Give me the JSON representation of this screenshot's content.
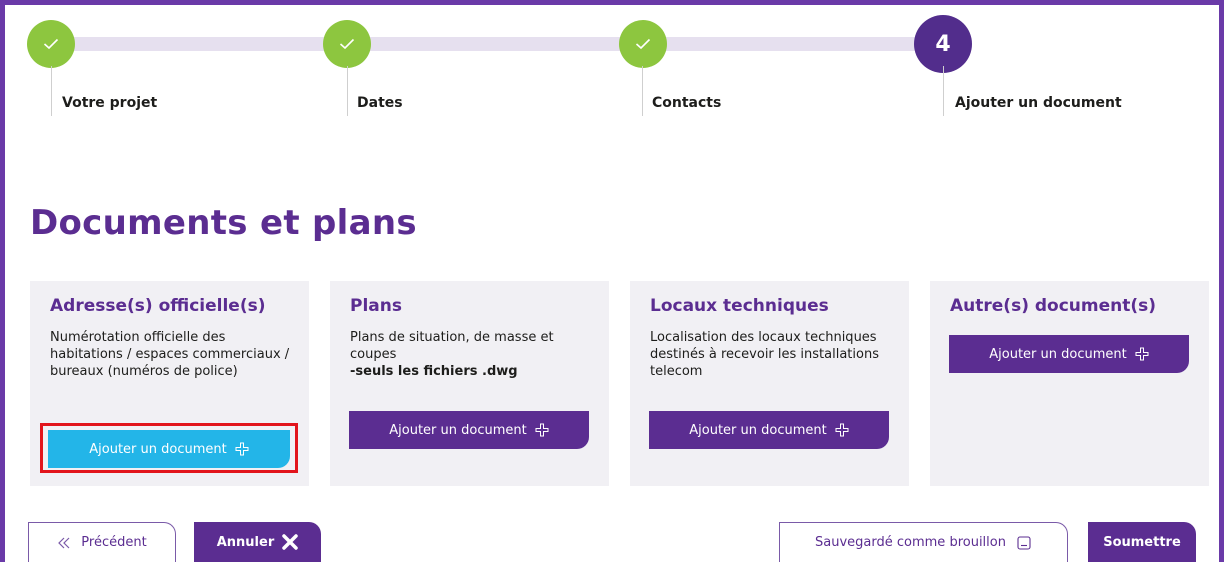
{
  "stepper": {
    "steps": [
      {
        "label": "Votre projet",
        "status": "done"
      },
      {
        "label": "Dates",
        "status": "done"
      },
      {
        "label": "Contacts",
        "status": "done"
      },
      {
        "label": "Ajouter un document",
        "status": "current",
        "number": "4"
      }
    ]
  },
  "page_title": "Documents et plans",
  "cards": [
    {
      "title": "Adresse(s) officielle(s)",
      "description": "Numérotation officielle des habitations / espaces commerciaux / bureaux (numéros de police)",
      "note": "",
      "button_label": "Ajouter un document",
      "button_state": "active"
    },
    {
      "title": "Plans",
      "description": "Plans de situation, de masse et coupes",
      "note": "-seuls les fichiers .dwg",
      "button_label": "Ajouter un document",
      "button_state": "default"
    },
    {
      "title": "Locaux techniques",
      "description": "Localisation des locaux techniques destinés à recevoir les installations telecom",
      "note": "",
      "button_label": "Ajouter un document",
      "button_state": "default"
    },
    {
      "title": "Autre(s) document(s)",
      "description": "",
      "note": "",
      "button_label": "Ajouter un document",
      "button_state": "default"
    }
  ],
  "footer": {
    "previous_label": "Précédent",
    "cancel_label": "Annuler",
    "save_draft_label": "Sauvegardé comme brouillon",
    "submit_label": "Soumettre"
  },
  "colors": {
    "brand_purple": "#5b2d91",
    "step_done_green": "#8dc63f",
    "active_button_blue": "#23b5e8",
    "highlight_red": "#e2141c"
  },
  "icons": {
    "step_done": "check-icon",
    "add": "plus-icon",
    "previous": "double-chevron-left-icon",
    "cancel": "close-x-icon",
    "save_draft": "document-icon"
  }
}
